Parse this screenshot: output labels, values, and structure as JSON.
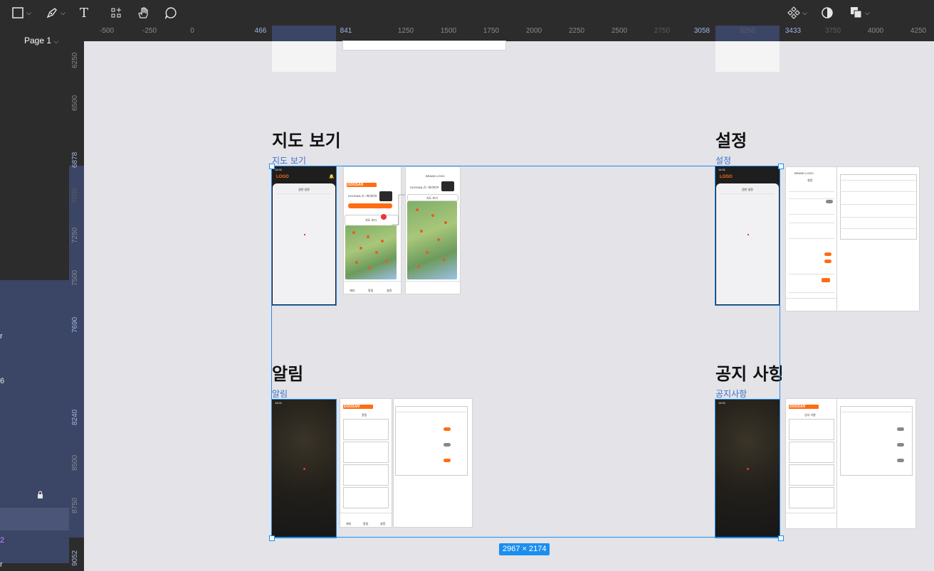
{
  "toolbar": {
    "tools": [
      "frame-tool",
      "pen-tool",
      "text-tool",
      "components-tool",
      "hand-tool",
      "comment-tool"
    ],
    "text_tool_glyph": "T",
    "right_tools": [
      "component-tool",
      "contrast-tool",
      "layers-tool"
    ]
  },
  "left_panel": {
    "page_label": "Page 1",
    "page_chevron": "⌄",
    "truncated_labels": [
      "r",
      "6",
      "2",
      "r"
    ]
  },
  "rulers": {
    "horizontal": [
      "-500",
      "-250",
      "0",
      "466",
      "841",
      "1250",
      "1500",
      "1750",
      "2000",
      "2250",
      "2500",
      "2750",
      "3058",
      "3250",
      "3433",
      "3750",
      "4000",
      "4250"
    ],
    "vertical": [
      "6250",
      "6500",
      "6878",
      "7000",
      "7250",
      "7500",
      "7690",
      "8240",
      "8500",
      "8750",
      "9052"
    ]
  },
  "canvas": {
    "sections": [
      {
        "title": "지도 보기",
        "label": "지도 보기"
      },
      {
        "title": "설정",
        "label": "설정"
      },
      {
        "title": "알림",
        "label": "알림"
      },
      {
        "title": "공지 사항",
        "label": "공지사항"
      }
    ],
    "selection_size": "2967 × 2174",
    "phone": {
      "time": "14:01",
      "logo": "LOGO",
      "menu_title": "권한 설정"
    },
    "map_mock": {
      "brand": "DOOSAN",
      "site": "DOOSAN-기 / 파라미프",
      "panel_title": "지도 보기",
      "brand_logo": "BRAND LOGO"
    },
    "settings_mock": {
      "brand_logo": "BRAND LOGO",
      "title": "설정"
    },
    "alert_mock": {
      "title": "알림"
    },
    "notice_mock": {
      "title": "공지 사항"
    },
    "nav": [
      "재지",
      "알림",
      "설정"
    ]
  },
  "colors": {
    "accent": "#1b8ff0",
    "brand": "#ff6d12",
    "selection": "#3b4566"
  }
}
